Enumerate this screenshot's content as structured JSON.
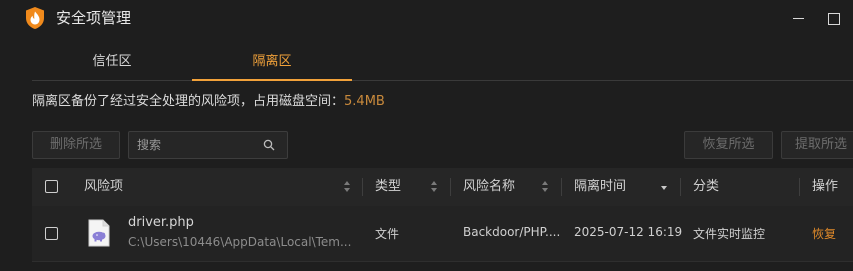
{
  "window": {
    "title": "安全项管理",
    "accent_color": "#f2a23a",
    "icon": "shield-flame-icon"
  },
  "tabs": [
    {
      "label": "信任区",
      "active": false
    },
    {
      "label": "隔离区",
      "active": true
    }
  ],
  "info": {
    "text": "隔离区备份了经过安全处理的风险项，占用磁盘空间：",
    "size": "5.4MB"
  },
  "toolbar": {
    "delete_label": "删除所选",
    "search_placeholder": "搜索",
    "restore_label": "恢复所选",
    "extract_label": "提取所选"
  },
  "table": {
    "headers": {
      "risk_item": "风险项",
      "type": "类型",
      "risk_name": "风险名称",
      "quarantine_time": "隔离时间",
      "category": "分类",
      "action": "操作"
    },
    "rows": [
      {
        "file_name": "driver.php",
        "file_path": "C:\\Users\\10446\\AppData\\Local\\Tem...",
        "type": "文件",
        "risk_name": "Backdoor/PHP....",
        "time": "2025-07-12 16:19",
        "category": "文件实时监控",
        "action": "恢复",
        "icon": "php-file-icon"
      }
    ]
  }
}
